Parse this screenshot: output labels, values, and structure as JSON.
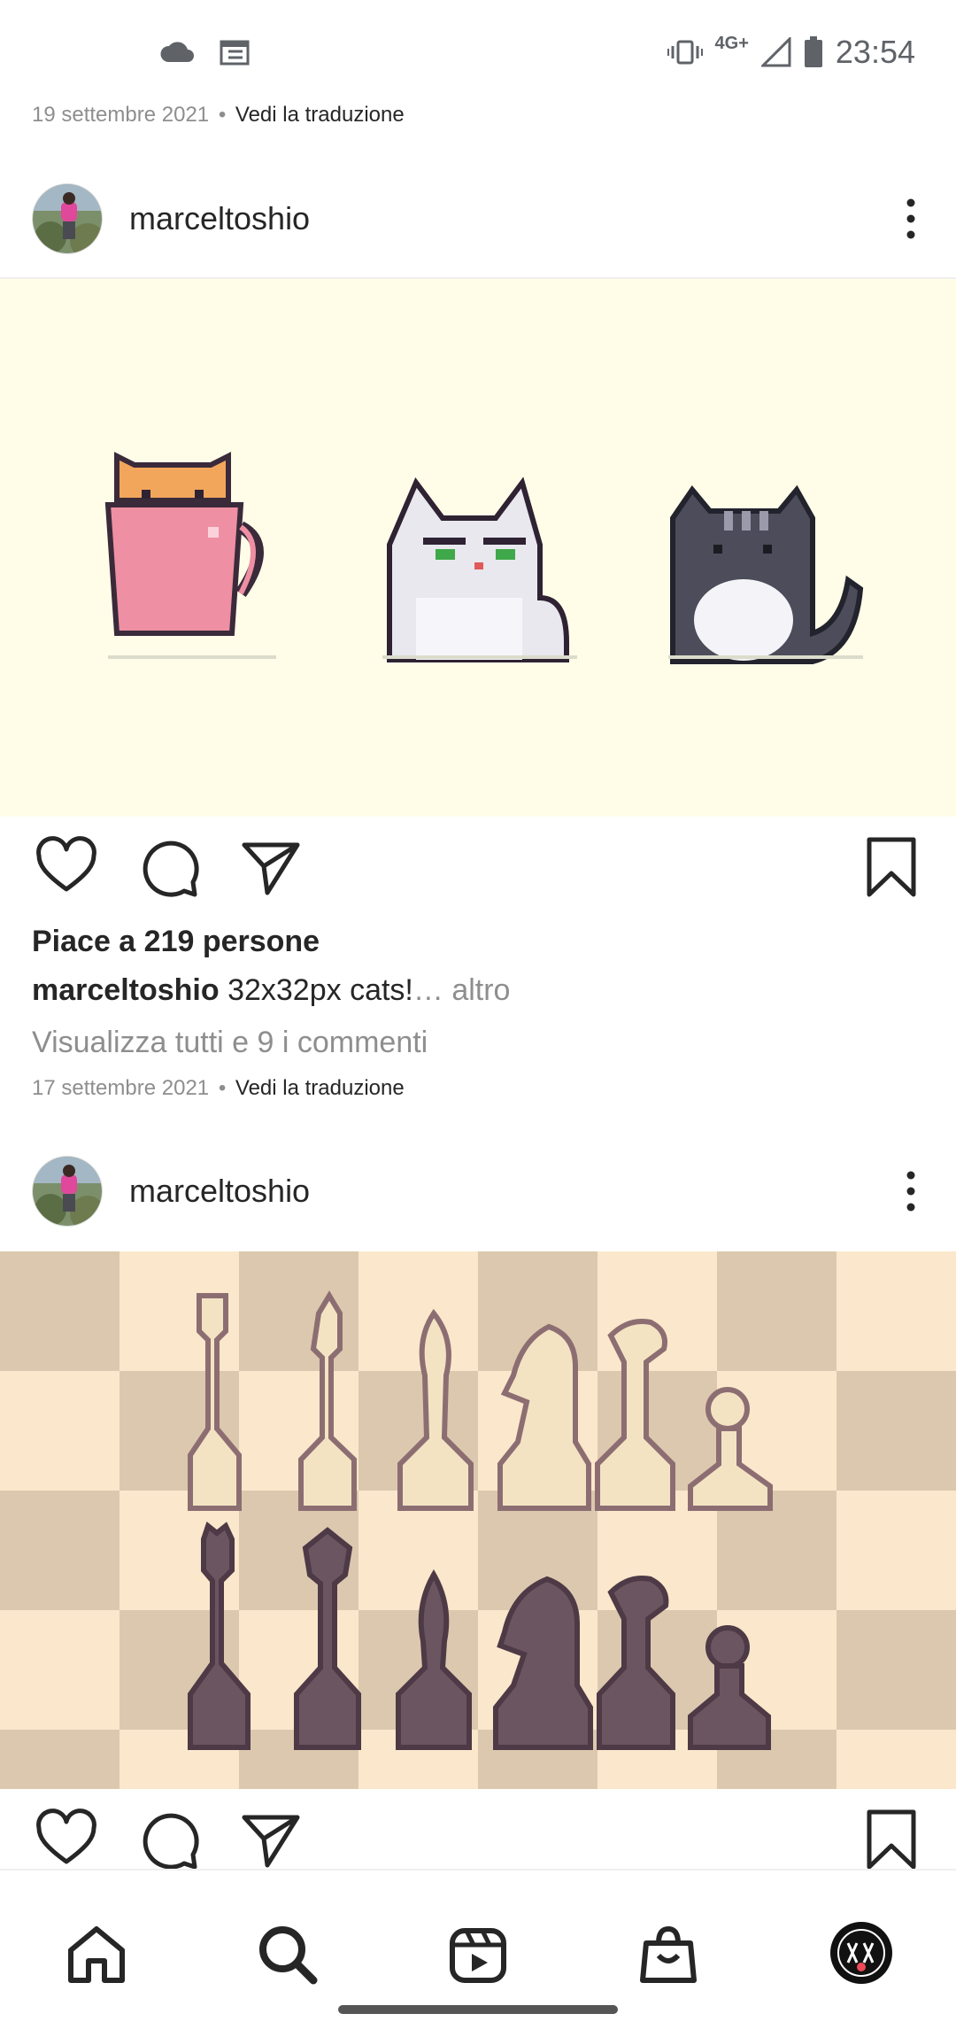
{
  "status_bar": {
    "time": "23:54",
    "network": "4G+",
    "icons": [
      "cloud-icon",
      "calendar-icon",
      "vibrate-icon",
      "signal-icon",
      "battery-icon"
    ]
  },
  "prev_post": {
    "date": "19 settembre 2021",
    "translate": "Vedi la traduzione"
  },
  "post1": {
    "username": "marceltoshio",
    "likes": "Piace a 219 persone",
    "caption_user": "marceltoshio",
    "caption_text": " 32x32px cats!",
    "caption_more": "… altro",
    "comments": "Visualizza tutti e 9 i commenti",
    "date": "17 settembre 2021",
    "translate": "Vedi la traduzione",
    "image_bg": "#fffde8"
  },
  "post2": {
    "username": "marceltoshio",
    "board_light": "#fbe7cb",
    "board_dark": "#dcc8ae"
  },
  "separator": "•",
  "nav": {
    "items": [
      "home-icon",
      "search-icon",
      "reels-icon",
      "shop-icon",
      "profile-avatar"
    ]
  }
}
